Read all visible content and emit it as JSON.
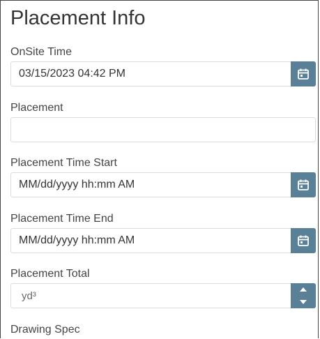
{
  "title": "Placement Info",
  "fields": {
    "onsite_time": {
      "label": "OnSite Time",
      "value": "03/15/2023 04:42 PM"
    },
    "placement": {
      "label": "Placement",
      "value": ""
    },
    "placement_time_start": {
      "label": "Placement Time Start",
      "placeholder": "MM/dd/yyyy hh:mm AM"
    },
    "placement_time_end": {
      "label": "Placement Time End",
      "placeholder": "MM/dd/yyyy hh:mm AM"
    },
    "placement_total": {
      "label": "Placement Total",
      "unit": "yd³"
    },
    "drawing_spec": {
      "label": "Drawing Spec"
    }
  },
  "icons": {
    "calendar": "calendar-icon",
    "spin_up": "arrow-up-icon",
    "spin_down": "arrow-down-icon"
  },
  "colors": {
    "accent": "#5a8098",
    "border": "#dcdcdc",
    "text": "#333333"
  }
}
